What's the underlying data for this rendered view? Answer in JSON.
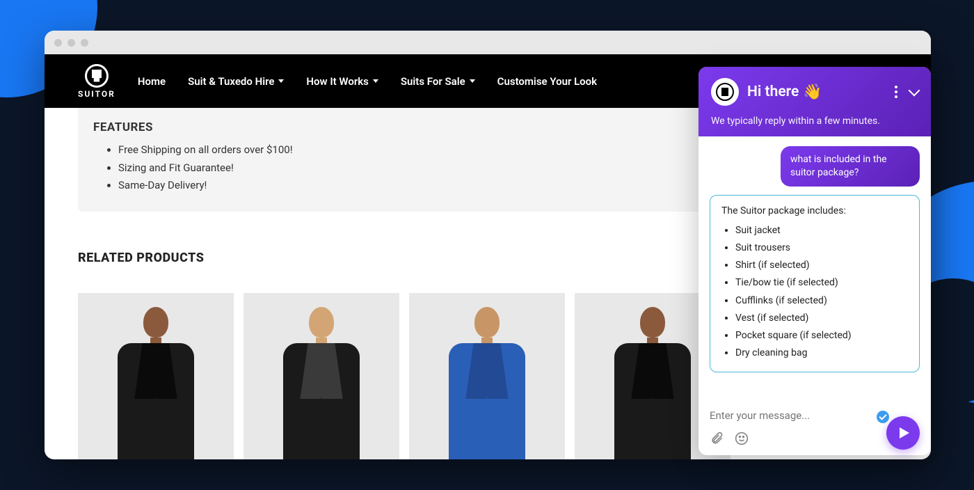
{
  "brand": {
    "name": "SUITOR"
  },
  "nav": {
    "items": [
      {
        "label": "Home",
        "dropdown": false
      },
      {
        "label": "Suit & Tuxedo Hire",
        "dropdown": true
      },
      {
        "label": "How It Works",
        "dropdown": true
      },
      {
        "label": "Suits For Sale",
        "dropdown": true
      },
      {
        "label": "Customise Your Look",
        "dropdown": false
      }
    ]
  },
  "features": {
    "title": "FEATURES",
    "items": [
      "Free Shipping on all orders over $100!",
      "Sizing and Fit Guarantee!",
      "Same-Day Delivery!"
    ]
  },
  "related": {
    "title": "RELATED PRODUCTS"
  },
  "chat": {
    "greeting": "Hi there",
    "wave": "👋",
    "subtitle": "We typically reply within a few minutes.",
    "user_message": "what is included in the suitor package?",
    "bot_intro": "The Suitor package includes:",
    "bot_items": [
      "Suit jacket",
      "Suit trousers",
      "Shirt (if selected)",
      "Tie/bow tie (if selected)",
      "Cufflinks (if selected)",
      "Vest (if selected)",
      "Pocket square (if selected)",
      "Dry cleaning bag"
    ],
    "input_placeholder": "Enter your message..."
  }
}
